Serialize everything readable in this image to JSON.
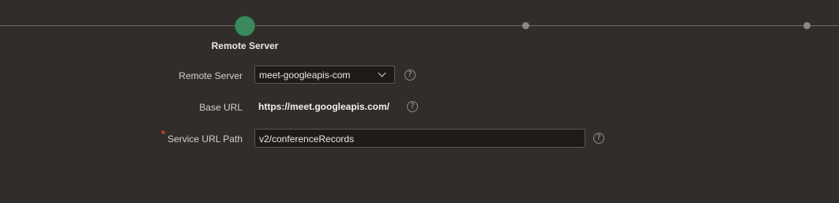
{
  "train": {
    "current_step_label": "Remote Server"
  },
  "form": {
    "remote_server": {
      "label": "Remote Server",
      "value": "meet-googleapis-com"
    },
    "base_url": {
      "label": "Base URL",
      "value": "https://meet.googleapis.com/"
    },
    "service_url_path": {
      "label": "Service URL Path",
      "required_mark": "*",
      "value": "v2/conferenceRecords"
    },
    "help_glyph": "?"
  },
  "colors": {
    "background": "#312d2a",
    "current_step": "#3b8a5e",
    "required": "#e0453a"
  }
}
